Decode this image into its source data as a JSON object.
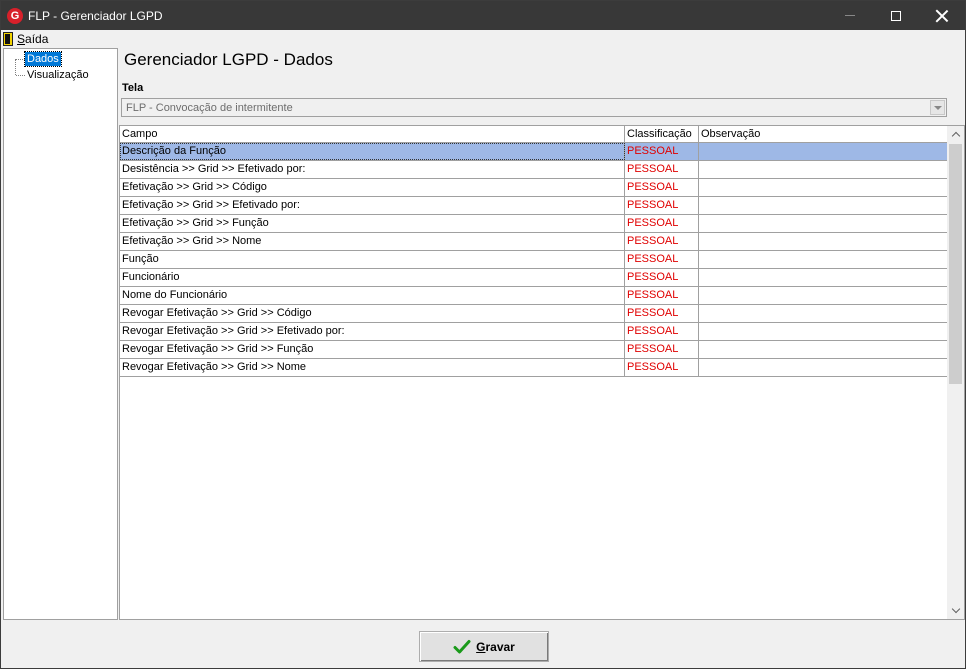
{
  "window": {
    "title": "FLP - Gerenciador LGPD"
  },
  "menu": {
    "exit_label": "Saída"
  },
  "tree": {
    "items": [
      {
        "label": "Dados",
        "selected": true
      },
      {
        "label": "Visualização",
        "selected": false
      }
    ]
  },
  "main": {
    "title": "Gerenciador LGPD - Dados",
    "screen_label": "Tela",
    "screen_value": "FLP - Convocação de intermitente"
  },
  "grid": {
    "columns": [
      "Campo",
      "Classificação",
      "Observação"
    ],
    "rows": [
      {
        "campo": "Descrição da Função",
        "classificacao": "PESSOAL",
        "observacao": ""
      },
      {
        "campo": "Desistência >> Grid >> Efetivado por:",
        "classificacao": "PESSOAL",
        "observacao": ""
      },
      {
        "campo": "Efetivação >> Grid >> Código",
        "classificacao": "PESSOAL",
        "observacao": ""
      },
      {
        "campo": "Efetivação >> Grid >> Efetivado por:",
        "classificacao": "PESSOAL",
        "observacao": ""
      },
      {
        "campo": "Efetivação >> Grid >> Função",
        "classificacao": "PESSOAL",
        "observacao": ""
      },
      {
        "campo": "Efetivação >> Grid >> Nome",
        "classificacao": "PESSOAL",
        "observacao": ""
      },
      {
        "campo": "Função",
        "classificacao": "PESSOAL",
        "observacao": ""
      },
      {
        "campo": "Funcionário",
        "classificacao": "PESSOAL",
        "observacao": ""
      },
      {
        "campo": "Nome do Funcionário",
        "classificacao": "PESSOAL",
        "observacao": ""
      },
      {
        "campo": "Revogar Efetivação >> Grid >> Código",
        "classificacao": "PESSOAL",
        "observacao": ""
      },
      {
        "campo": "Revogar Efetivação >> Grid >> Efetivado por:",
        "classificacao": "PESSOAL",
        "observacao": ""
      },
      {
        "campo": "Revogar Efetivação >> Grid >> Função",
        "classificacao": "PESSOAL",
        "observacao": ""
      },
      {
        "campo": "Revogar Efetivação >> Grid >> Nome",
        "classificacao": "PESSOAL",
        "observacao": ""
      }
    ],
    "selected_row": 0
  },
  "footer": {
    "save_label": "Gravar"
  },
  "colors": {
    "titlebar": "#383838",
    "selection": "#9eb8e6",
    "classification_text": "#e00000",
    "tree_selection": "#0078d7",
    "check_icon": "#1a9a1a"
  }
}
